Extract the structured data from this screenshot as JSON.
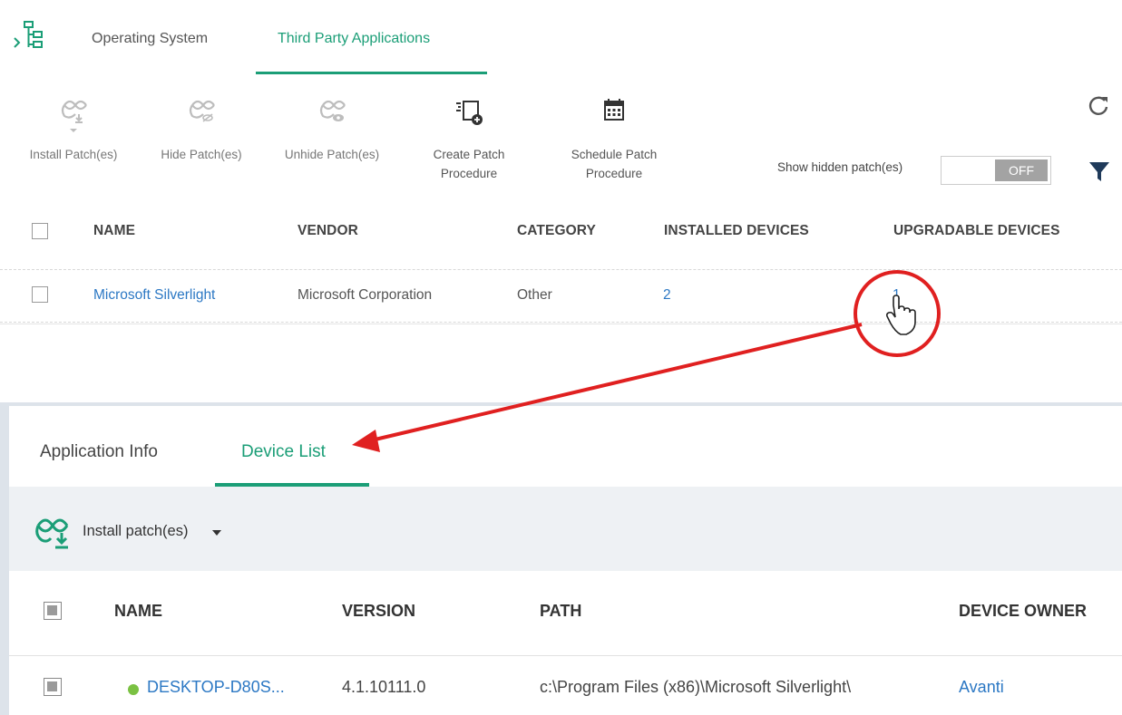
{
  "top_tabs": [
    {
      "label": "Operating System"
    },
    {
      "label": "Third Party Applications"
    }
  ],
  "toolbar": {
    "install": "Install Patch(es)",
    "hide": "Hide Patch(es)",
    "unhide": "Unhide Patch(es)",
    "create_line1": "Create Patch",
    "create_line2": "Procedure",
    "schedule_line1": "Schedule Patch",
    "schedule_line2": "Procedure",
    "show_hidden_label": "Show hidden patch(es)",
    "toggle_state": "OFF"
  },
  "apps_table": {
    "headers": [
      "NAME",
      "VENDOR",
      "CATEGORY",
      "INSTALLED DEVICES",
      "UPGRADABLE DEVICES"
    ],
    "rows": [
      {
        "name": "Microsoft Silverlight",
        "vendor": "Microsoft Corporation",
        "category": "Other",
        "installed": "2",
        "upgradable": "1"
      }
    ]
  },
  "detail_tabs": [
    {
      "label": "Application Info"
    },
    {
      "label": "Device List"
    }
  ],
  "device_toolbar": {
    "install_label": "Install patch(es)"
  },
  "device_table": {
    "headers": [
      "NAME",
      "VERSION",
      "PATH",
      "DEVICE OWNER"
    ],
    "rows": [
      {
        "name": "DESKTOP-D80S...",
        "version": "4.1.10111.0",
        "path": "c:\\Program Files (x86)\\Microsoft Silverlight\\",
        "owner": "Avanti"
      }
    ]
  },
  "colors": {
    "accent": "#1b9e77",
    "link": "#2c78c4",
    "annotation": "#e02020",
    "online": "#7ac142"
  }
}
